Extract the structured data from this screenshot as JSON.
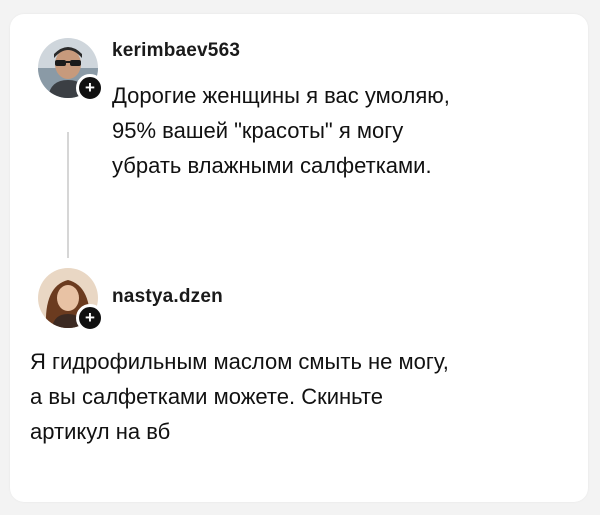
{
  "post1": {
    "username": "kerimbaev563",
    "text": "Дорогие женщины я вас умоляю,\n95% вашей \"красоты\" я могу\nубрать влажными салфетками."
  },
  "post2": {
    "username": "nastya.dzen",
    "text": "Я гидрофильным маслом смыть не могу,\nа вы салфетками можете. Скиньте\nартикул на вб"
  },
  "follow_symbol": "+"
}
